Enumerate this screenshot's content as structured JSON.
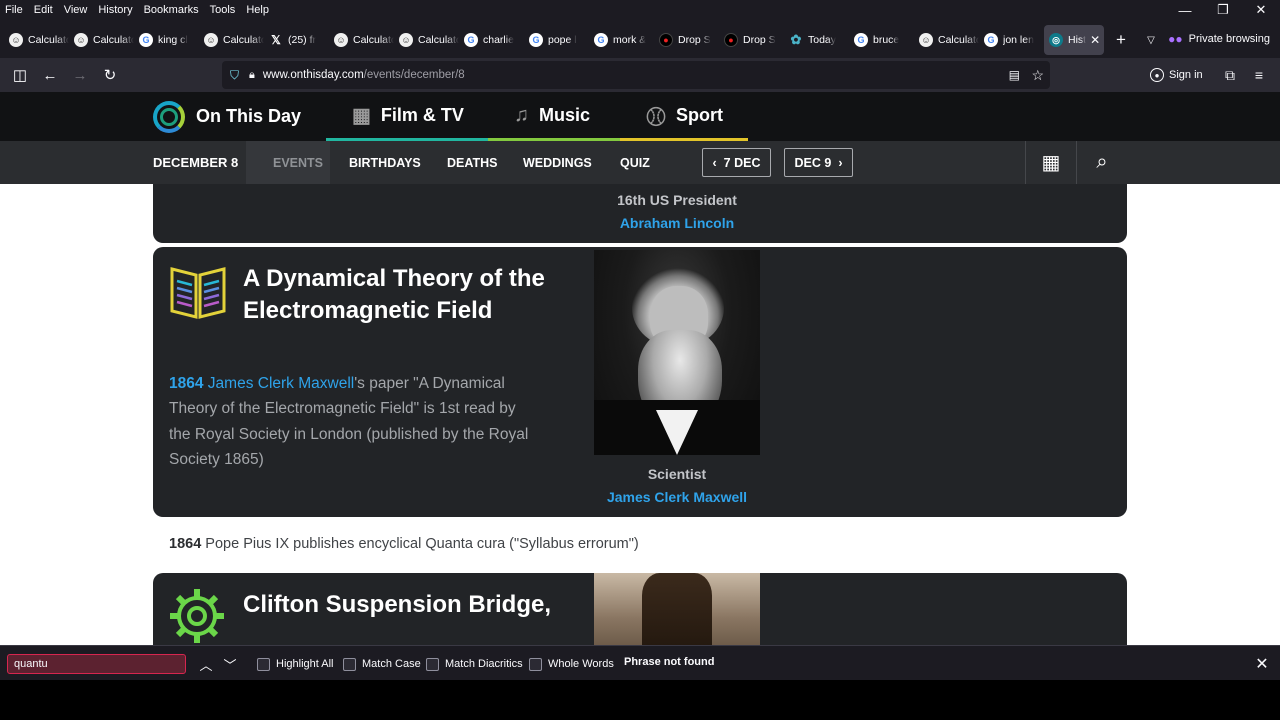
{
  "menubar": {
    "items": [
      "File",
      "Edit",
      "View",
      "History",
      "Bookmarks",
      "Tools",
      "Help"
    ]
  },
  "window_controls": {
    "minimize": "—",
    "restore": "❐",
    "close": "✕"
  },
  "tabs": [
    {
      "label": "Calculator",
      "icon": "calculator-icon"
    },
    {
      "label": "Calculator",
      "icon": "calculator-icon"
    },
    {
      "label": "king cl",
      "icon": "google-icon"
    },
    {
      "label": "Calculator",
      "icon": "calculator-icon"
    },
    {
      "label": "(25) fr",
      "icon": "x-icon"
    },
    {
      "label": "Calculator",
      "icon": "calculator-icon"
    },
    {
      "label": "Calculator",
      "icon": "calculator-icon"
    },
    {
      "label": "charlie",
      "icon": "google-icon"
    },
    {
      "label": "pope l",
      "icon": "google-icon"
    },
    {
      "label": "mork &",
      "icon": "google-icon"
    },
    {
      "label": "Drop S",
      "icon": "drop-icon"
    },
    {
      "label": "Drop S",
      "icon": "drop-icon"
    },
    {
      "label": "Today",
      "icon": "today-icon"
    },
    {
      "label": "bruce",
      "icon": "google-icon"
    },
    {
      "label": "Calculator",
      "icon": "calculator-icon"
    },
    {
      "label": "jon len",
      "icon": "google-icon"
    },
    {
      "label": "Hist",
      "icon": "onthisday-icon",
      "active": true
    }
  ],
  "private_browsing": "Private browsing",
  "navbar": {
    "url_host": "www.onthisday.com",
    "url_path": "/events/december/8",
    "signin": "Sign in"
  },
  "site": {
    "logo": "On This Day",
    "sections": [
      {
        "label": "Film & TV",
        "color": "#21b6a0"
      },
      {
        "label": "Music",
        "color": "#83c93f"
      },
      {
        "label": "Sport",
        "color": "#e2c42a"
      }
    ],
    "subnav": {
      "date": "DECEMBER 8",
      "events": "EVENTS",
      "birthdays": "BIRTHDAYS",
      "deaths": "DEATHS",
      "weddings": "WEDDINGS",
      "quiz": "QUIZ",
      "prev_day": "7 DEC",
      "next_day": "DEC 9"
    }
  },
  "content": {
    "top_card": {
      "role": "16th US President",
      "name": "Abraham Lincoln"
    },
    "main_event": {
      "title": "A Dynamical Theory of the Electromagnetic Field",
      "year": "1864",
      "person_link": "James Clerk Maxwell",
      "text": "'s paper \"A Dynamical Theory of the Electromagnetic Field\" is 1st read by the Royal Society in London (published by the Royal Society 1865)",
      "caption_role": "Scientist",
      "caption_name": "James Clerk Maxwell"
    },
    "plain_event": {
      "year": "1864",
      "text": "Pope Pius IX publishes encyclical Quanta cura (\"Syllabus errorum\")"
    },
    "next_event": {
      "title": "Clifton Suspension Bridge,"
    }
  },
  "findbar": {
    "query": "quantu",
    "highlight_all": "Highlight All",
    "match_case": "Match Case",
    "match_diacritics": "Match Diacritics",
    "whole_words": "Whole Words",
    "status": "Phrase not found"
  },
  "colors": {
    "link_blue": "#2fa3ea",
    "find_not_found": "#d7264f"
  }
}
